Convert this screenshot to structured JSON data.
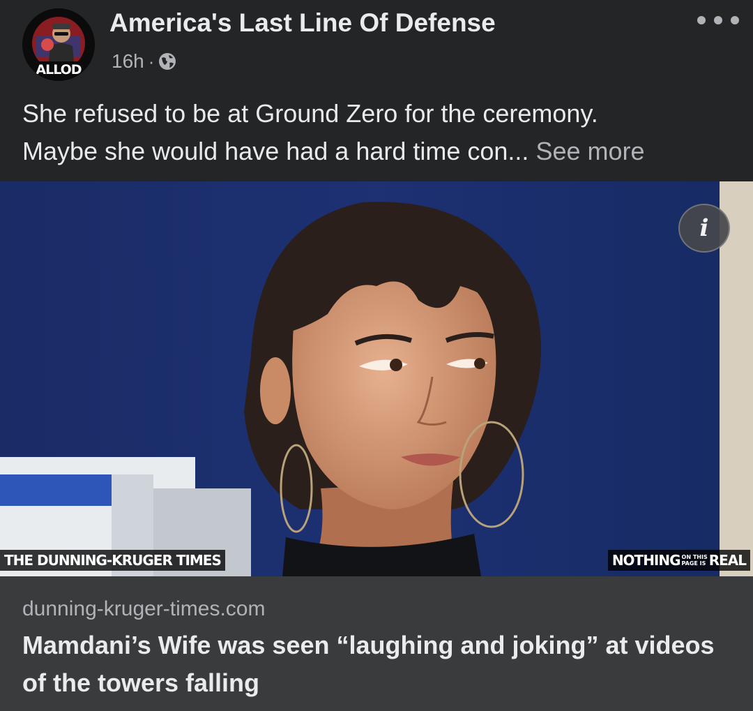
{
  "post": {
    "page_name": "America's Last Line Of Defense",
    "avatar_text": "ALLOD",
    "time": "16h",
    "separator": "·",
    "privacy_icon": "globe-icon",
    "more_icon": "more-options-icon",
    "caption_line1": "She refused to be at Ground Zero for the ceremony.",
    "caption_line2": "Maybe she would have had a hard time con...",
    "see_more": "See more"
  },
  "image": {
    "info_icon": "i",
    "watermark_left": "THE DUNNING-KRUGER TIMES",
    "watermark_right_1": "NOTHING",
    "watermark_right_small_top": "ON THIS",
    "watermark_right_small_bottom": "PAGE IS",
    "watermark_right_2": "REAL"
  },
  "link": {
    "domain": "dunning-kruger-times.com",
    "headline_line1": "Mamdani’s Wife was seen “laughing and joking” at videos",
    "headline_line2": "of the towers falling"
  },
  "colors": {
    "background": "#242526",
    "link_background": "#3a3b3c",
    "text_primary": "#e4e6eb",
    "text_secondary": "#b0b3b8"
  }
}
